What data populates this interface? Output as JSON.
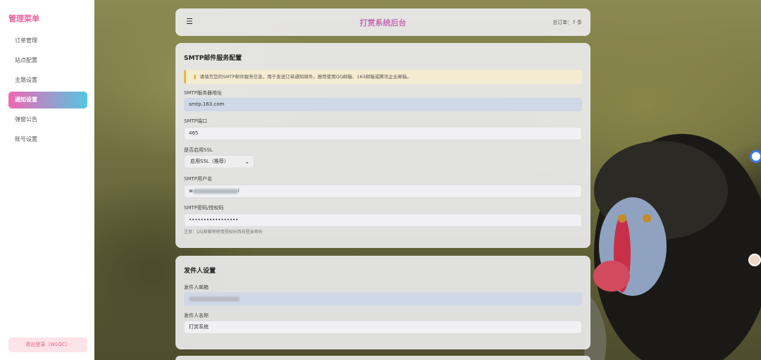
{
  "sidebar": {
    "title": "管理菜单",
    "items": [
      {
        "label": "订单管理"
      },
      {
        "label": "站点配置"
      },
      {
        "label": "主题设置"
      },
      {
        "label": "通知设置"
      },
      {
        "label": "弹窗公告"
      },
      {
        "label": "账号设置"
      }
    ],
    "active_index": 3,
    "logout_label": "退出登录（WLQC）"
  },
  "header": {
    "menu_icon": "☰",
    "title": "打赏系统后台",
    "order_count": "总订单：7 条"
  },
  "smtp": {
    "title": "SMTP邮件服务配置",
    "notice": "请填写您的SMTP邮件服务信息，用于发送订单通知邮件。推荐使用QQ邮箱、163邮箱或腾讯企业邮箱。",
    "server_label": "SMTP服务器地址",
    "server_value": "smtp.163.com",
    "port_label": "SMTP端口",
    "port_value": "465",
    "ssl_label": "是否启用SSL",
    "ssl_value": "启用SSL（推荐）",
    "username_label": "SMTP用户名",
    "username_value": "w",
    "username_suffix": "l",
    "password_label": "SMTP密码/授权码",
    "password_value": "•••••••••••••••••",
    "hint": "注意：QQ邮箱等使用授权码而非登录密码"
  },
  "sender": {
    "title": "发件人设置",
    "email_label": "发件人邮箱",
    "name_label": "发件人名称",
    "name_value": "打赏系统"
  },
  "colors": {
    "accent_pink": "#f067b4",
    "accent_cyan": "#54c6e0",
    "notice_border": "#e7b83a"
  }
}
